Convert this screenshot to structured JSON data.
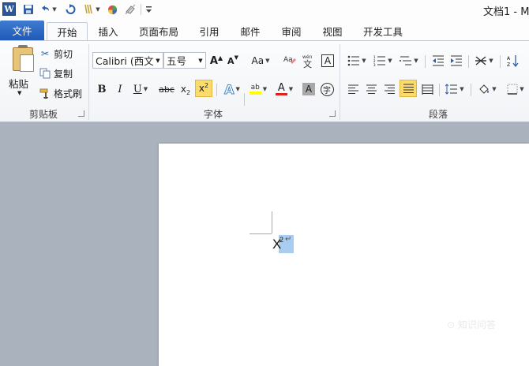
{
  "titlebar": {
    "app_icon_letter": "W",
    "document_title": "文档1 - M"
  },
  "tabs": [
    {
      "label": "文件"
    },
    {
      "label": "开始"
    },
    {
      "label": "插入"
    },
    {
      "label": "页面布局"
    },
    {
      "label": "引用"
    },
    {
      "label": "邮件"
    },
    {
      "label": "审阅"
    },
    {
      "label": "视图"
    },
    {
      "label": "开发工具"
    }
  ],
  "clipboard": {
    "paste_label": "粘贴",
    "cut_label": "剪切",
    "copy_label": "复制",
    "format_painter_label": "格式刷",
    "group_label": "剪贴板"
  },
  "font": {
    "font_name": "Calibri (西文",
    "font_size": "五号",
    "change_case_label": "Aa",
    "bold_label": "B",
    "italic_label": "I",
    "underline_label": "U",
    "strike_label": "abc",
    "subscript_label": "x",
    "superscript_label": "x",
    "group_label": "字体"
  },
  "paragraph": {
    "group_label": "段落"
  },
  "document": {
    "base_text": "X",
    "superscript_text": "2",
    "paragraph_mark": "↵"
  },
  "watermark": "⊙ 知识问答"
}
